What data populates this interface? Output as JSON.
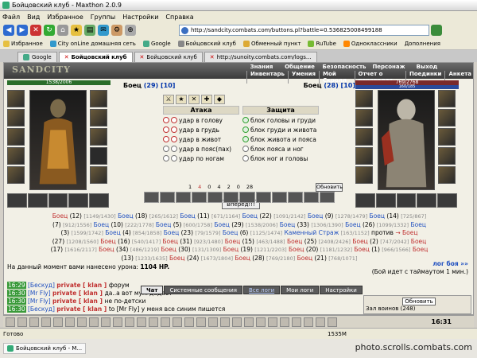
{
  "window": {
    "title": "Бойцовский клуб - Maxthon 2.0.9"
  },
  "menu": [
    "Файл",
    "Вид",
    "Избранное",
    "Группы",
    "Настройки",
    "Справка"
  ],
  "address": {
    "url": "http://sandcity.combats.com/buttons.pl?battle=0.536825008499188"
  },
  "bookmarks": [
    "Избранное",
    "City onLine домашняя сеть",
    "Google",
    "Бойцовский клуб",
    "Обменный пункт",
    "RuTube",
    "Одноклассники",
    "Дополнения"
  ],
  "tabs": [
    {
      "label": "Google",
      "active": false
    },
    {
      "label": "Бойцовский клуб",
      "active": true
    },
    {
      "label": "Бойцовский клуб",
      "active": false
    },
    {
      "label": "http://sunoity.combats.com/logs...",
      "active": false
    }
  ],
  "game": {
    "logo": "SANDCITY",
    "menu_top": [
      "Знания",
      "Общение",
      "Безопасность",
      "Персонаж",
      "Выход"
    ],
    "menu_bottom": [
      "Инвентарь",
      "Умения",
      "Мой Скролл",
      "Отчет о переводах",
      "Поединки",
      "Анкета"
    ],
    "player1": {
      "name": "Боец",
      "level": "(29) [10]",
      "hp": "1538/2006",
      "mp": ""
    },
    "player2": {
      "name": "Боец",
      "level": "(28) [10]",
      "hp": "769/2768",
      "mp": "160/185"
    },
    "attack_title": "Атака",
    "defense_title": "Защита",
    "attack_options": [
      "удар в голову",
      "удар в грудь",
      "удар в живот",
      "удар в пояс(пах)",
      "удар по ногам"
    ],
    "defense_options": [
      "блок головы и груди",
      "блок груди и живота",
      "блок живота и пояса",
      "блок пояса и ног",
      "блок ног и головы"
    ],
    "attack_button": "Вперёд!!!",
    "stats": [
      "1",
      "4",
      "0",
      "4",
      "2",
      "0",
      "28"
    ],
    "refresh_button": "Обновить",
    "battle_log": [
      [
        {
          "t": "Боец",
          "c": "r"
        },
        {
          "t": " (12) ",
          "c": ""
        },
        {
          "t": "[1149/1430]",
          "c": "gr"
        },
        {
          "t": " Боец",
          "c": "b"
        },
        {
          "t": " (18) ",
          "c": ""
        },
        {
          "t": "[265/1612]",
          "c": "gr"
        },
        {
          "t": " Боец",
          "c": "b"
        },
        {
          "t": " (11) ",
          "c": ""
        },
        {
          "t": "[671/1164]",
          "c": "gr"
        },
        {
          "t": " Боец",
          "c": "b"
        },
        {
          "t": " (22) ",
          "c": ""
        },
        {
          "t": "[1091/2142]",
          "c": "gr"
        },
        {
          "t": " Боец",
          "c": "b"
        },
        {
          "t": " (9) ",
          "c": ""
        },
        {
          "t": "[1278/1479]",
          "c": "gr"
        },
        {
          "t": " Боец",
          "c": "b"
        },
        {
          "t": " (14) ",
          "c": ""
        },
        {
          "t": "[725/867]",
          "c": "gr"
        }
      ],
      [
        {
          "t": "(7) ",
          "c": ""
        },
        {
          "t": "[912/1556]",
          "c": "gr"
        },
        {
          "t": " Боец",
          "c": "b"
        },
        {
          "t": " (10) ",
          "c": ""
        },
        {
          "t": "[222/1778]",
          "c": "gr"
        },
        {
          "t": " Боец",
          "c": "b"
        },
        {
          "t": " (5) ",
          "c": ""
        },
        {
          "t": "[600/1758]",
          "c": "gr"
        },
        {
          "t": " Боец",
          "c": "b"
        },
        {
          "t": " (29) ",
          "c": ""
        },
        {
          "t": "[1538/2006]",
          "c": "gr"
        },
        {
          "t": " Боец",
          "c": "b"
        },
        {
          "t": " (33) ",
          "c": ""
        },
        {
          "t": "[1306/1390]",
          "c": "gr"
        },
        {
          "t": " Боец",
          "c": "b"
        },
        {
          "t": " (26) ",
          "c": ""
        },
        {
          "t": "[1099/1332]",
          "c": "gr"
        },
        {
          "t": " Боец",
          "c": "b"
        }
      ],
      [
        {
          "t": "(3) ",
          "c": ""
        },
        {
          "t": "[1599/1742]",
          "c": "gr"
        },
        {
          "t": " Боец",
          "c": "b"
        },
        {
          "t": " (4) ",
          "c": ""
        },
        {
          "t": "[854/1858]",
          "c": "gr"
        },
        {
          "t": " Боец",
          "c": "b"
        },
        {
          "t": " (23) ",
          "c": ""
        },
        {
          "t": "[79/1579]",
          "c": "gr"
        },
        {
          "t": " Боец",
          "c": "b"
        },
        {
          "t": " (6) ",
          "c": ""
        },
        {
          "t": "[1125/1474]",
          "c": "gr"
        },
        {
          "t": " Каменный Страж",
          "c": "b"
        },
        {
          "t": " [163/1152]",
          "c": "gr"
        },
        {
          "t": " против ",
          "c": ""
        },
        {
          "t": "→ Боец",
          "c": "r"
        }
      ],
      [
        {
          "t": "(27) ",
          "c": ""
        },
        {
          "t": "[1208/1560]",
          "c": "gr"
        },
        {
          "t": " Боец",
          "c": "r"
        },
        {
          "t": " (16) ",
          "c": ""
        },
        {
          "t": "[540/1417]",
          "c": "gr"
        },
        {
          "t": " Боец",
          "c": "r"
        },
        {
          "t": " (31) ",
          "c": ""
        },
        {
          "t": "[923/1480]",
          "c": "gr"
        },
        {
          "t": " Боец",
          "c": "r"
        },
        {
          "t": " (15) ",
          "c": ""
        },
        {
          "t": "[463/1488]",
          "c": "gr"
        },
        {
          "t": " Боец",
          "c": "r"
        },
        {
          "t": " (25) ",
          "c": ""
        },
        {
          "t": "[2408/2426]",
          "c": "gr"
        },
        {
          "t": " Боец",
          "c": "r"
        },
        {
          "t": " (2) ",
          "c": ""
        },
        {
          "t": "[747/2042]",
          "c": "gr"
        },
        {
          "t": " Боец",
          "c": "r"
        }
      ],
      [
        {
          "t": "(17) ",
          "c": ""
        },
        {
          "t": "[1616/2117]",
          "c": "gr"
        },
        {
          "t": " Боец",
          "c": "r"
        },
        {
          "t": " (34) ",
          "c": ""
        },
        {
          "t": "[486/1219]",
          "c": "gr"
        },
        {
          "t": " Боец",
          "c": "r"
        },
        {
          "t": " (30) ",
          "c": ""
        },
        {
          "t": "[131/1309]",
          "c": "gr"
        },
        {
          "t": " Боец",
          "c": "r"
        },
        {
          "t": " (19) ",
          "c": ""
        },
        {
          "t": "[1211/2203]",
          "c": "gr"
        },
        {
          "t": " Боец",
          "c": "r"
        },
        {
          "t": " (20) ",
          "c": ""
        },
        {
          "t": "[1181/1232]",
          "c": "gr"
        },
        {
          "t": " Боец",
          "c": "r"
        },
        {
          "t": " (1) ",
          "c": ""
        },
        {
          "t": "[966/1566]",
          "c": "gr"
        },
        {
          "t": " Боец",
          "c": "r"
        }
      ],
      [
        {
          "t": "(13) ",
          "c": ""
        },
        {
          "t": "[1233/1635]",
          "c": "gr"
        },
        {
          "t": " Боец",
          "c": "r"
        },
        {
          "t": " (24) ",
          "c": ""
        },
        {
          "t": "[1673/1804]",
          "c": "gr"
        },
        {
          "t": " Боец",
          "c": "r"
        },
        {
          "t": " (28) ",
          "c": ""
        },
        {
          "t": "[769/2180]",
          "c": "gr"
        },
        {
          "t": " Боец",
          "c": "r"
        },
        {
          "t": " (21) ",
          "c": ""
        },
        {
          "t": "[768/1071]",
          "c": "gr"
        }
      ]
    ],
    "damage_label": "На данный момент вами нанесено урона:",
    "damage_value": "1104 HP.",
    "log_link": "лог боя »»",
    "timeout": "(Бой идет с таймаутом 1 мин.)"
  },
  "chat": {
    "tabs": [
      {
        "label": "Чат",
        "style": "act"
      },
      {
        "label": "Системные сообщения",
        "style": ""
      },
      {
        "label": "Все логи",
        "style": "link"
      },
      {
        "label": "Мои логи",
        "style": ""
      },
      {
        "label": "Настройки",
        "style": ""
      }
    ],
    "lines": [
      {
        "time": "16:29",
        "user": "[Бескуд]",
        "tag": "private [ klan ]",
        "text": "форум"
      },
      {
        "time": "16:30",
        "user": "[Mr Fly]",
        "tag": "private [ klan ]",
        "text": "да..а вот муж дадает"
      },
      {
        "time": "16:30",
        "user": "[Mr Fly]",
        "tag": "private [ klan ]",
        "text": "не по-детски"
      },
      {
        "time": "16:30",
        "user": "[Бескуд]",
        "tag": "private [ klan ]",
        "text": "to [Mr Fly] у меня все синим пишется"
      }
    ],
    "side_button": "Обновить",
    "side_text": "Зал воинов (248)"
  },
  "clock": "16:31",
  "status": {
    "left": "Готово",
    "mem": "1535M"
  },
  "taskbar": {
    "task": "Бойцовский клуб - M...",
    "watermark": "photo.scrolls.combats.com"
  }
}
